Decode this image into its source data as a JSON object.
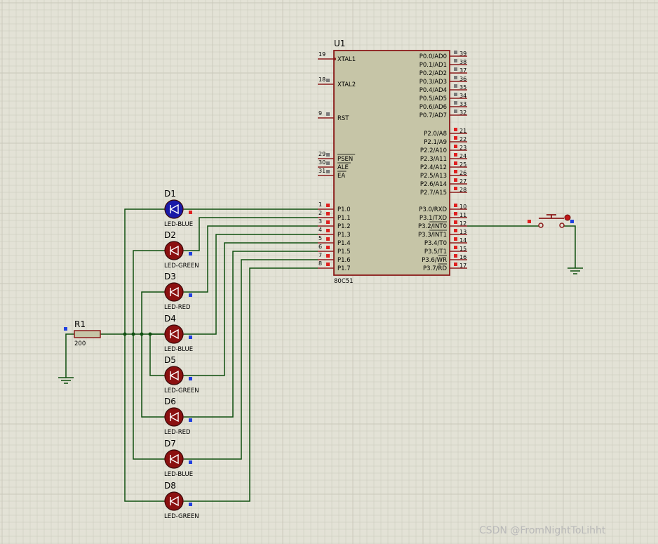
{
  "mcu": {
    "ref": "U1",
    "part": "80C51",
    "left_pins": [
      {
        "num": "19",
        "name": "XTAL1"
      },
      {
        "num": "18",
        "name": "XTAL2"
      },
      {
        "num": "9",
        "name": "RST"
      },
      {
        "num": "29",
        "name": "PSEN"
      },
      {
        "num": "30",
        "name": "ALE"
      },
      {
        "num": "31",
        "name": "EA"
      },
      {
        "num": "1",
        "name": "P1.0"
      },
      {
        "num": "2",
        "name": "P1.1"
      },
      {
        "num": "3",
        "name": "P1.2"
      },
      {
        "num": "4",
        "name": "P1.3"
      },
      {
        "num": "5",
        "name": "P1.4"
      },
      {
        "num": "6",
        "name": "P1.5"
      },
      {
        "num": "7",
        "name": "P1.6"
      },
      {
        "num": "8",
        "name": "P1.7"
      }
    ],
    "right_pins": [
      {
        "num": "39",
        "name": "P0.0/AD0"
      },
      {
        "num": "38",
        "name": "P0.1/AD1"
      },
      {
        "num": "37",
        "name": "P0.2/AD2"
      },
      {
        "num": "36",
        "name": "P0.3/AD3"
      },
      {
        "num": "35",
        "name": "P0.4/AD4"
      },
      {
        "num": "34",
        "name": "P0.5/AD5"
      },
      {
        "num": "33",
        "name": "P0.6/AD6"
      },
      {
        "num": "32",
        "name": "P0.7/AD7"
      },
      {
        "num": "21",
        "name": "P2.0/A8"
      },
      {
        "num": "22",
        "name": "P2.1/A9"
      },
      {
        "num": "23",
        "name": "P2.2/A10"
      },
      {
        "num": "24",
        "name": "P2.3/A11"
      },
      {
        "num": "25",
        "name": "P2.4/A12"
      },
      {
        "num": "26",
        "name": "P2.5/A13"
      },
      {
        "num": "27",
        "name": "P2.6/A14"
      },
      {
        "num": "28",
        "name": "P2.7/A15"
      },
      {
        "num": "10",
        "name": "P3.0/RXD"
      },
      {
        "num": "11",
        "name": "P3.1/TXD"
      },
      {
        "num": "12",
        "name": "P3.2/INT0"
      },
      {
        "num": "13",
        "name": "P3.3/INT1"
      },
      {
        "num": "14",
        "name": "P3.4/T0"
      },
      {
        "num": "15",
        "name": "P3.5/T1"
      },
      {
        "num": "16",
        "name": "P3.6/WR"
      },
      {
        "num": "17",
        "name": "P3.7/RD"
      }
    ]
  },
  "leds": [
    {
      "ref": "D1",
      "type": "LED-BLUE"
    },
    {
      "ref": "D2",
      "type": "LED-GREEN"
    },
    {
      "ref": "D3",
      "type": "LED-RED"
    },
    {
      "ref": "D4",
      "type": "LED-BLUE"
    },
    {
      "ref": "D5",
      "type": "LED-GREEN"
    },
    {
      "ref": "D6",
      "type": "LED-RED"
    },
    {
      "ref": "D7",
      "type": "LED-BLUE"
    },
    {
      "ref": "D8",
      "type": "LED-GREEN"
    }
  ],
  "resistor": {
    "ref": "R1",
    "value": "200"
  },
  "watermark": "CSDN @FromNightToLihht",
  "colors": {
    "background": "#e3e2d6",
    "grid": "#c9c8ba",
    "wire": "#0f4f0f",
    "chip_fill": "#c6c5a7",
    "chip_border": "#8b1a1a",
    "led_fill": "#8b1010",
    "led_active_fill": "#1a1aa8",
    "pin_red": "#e02020",
    "pin_blue": "#2040e0",
    "pin_gray": "#7a7a7a"
  }
}
